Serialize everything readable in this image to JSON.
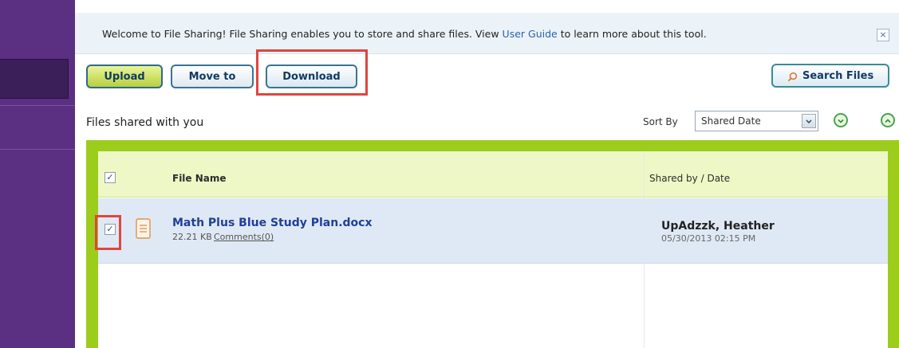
{
  "welcome": {
    "text_before": "Welcome to File Sharing! File Sharing enables you to store and share files. View ",
    "link": "User Guide",
    "text_after": " to learn more about this tool.",
    "close": "×"
  },
  "toolbar": {
    "upload_label": "Upload",
    "move_label": "Move to",
    "download_label": "Download",
    "search_label": "Search Files"
  },
  "list": {
    "title": "Files shared with you",
    "sort_label": "Sort By",
    "sort_value": "Shared Date"
  },
  "table": {
    "headers": {
      "file_name": "File Name",
      "shared_by": "Shared by / Date"
    },
    "rows": [
      {
        "checked": true,
        "name": "Math Plus Blue Study Plan.docx",
        "size": "22.21 KB",
        "comments": "Comments(0)",
        "shared_by": "UpAdzzk, Heather",
        "date": "05/30/2013 02:15 PM"
      }
    ]
  },
  "colors": {
    "sidebar": "#5b2f82",
    "panel_green": "#9ccc1c",
    "highlight_red": "#e0453e",
    "link_blue": "#2a62b0"
  },
  "icons": [
    "close-icon",
    "search-icon",
    "sort-down-icon",
    "sort-up-icon",
    "document-icon",
    "chevron-down-icon",
    "checkbox-icon"
  ]
}
